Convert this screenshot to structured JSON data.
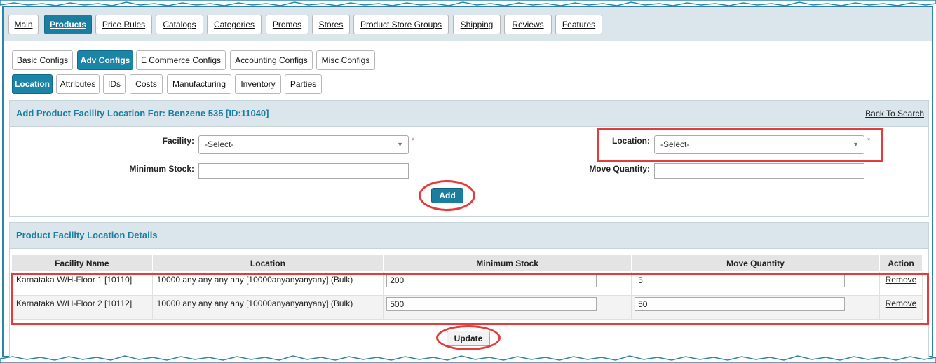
{
  "main_tabs": [
    {
      "label": "Main",
      "active": false
    },
    {
      "label": "Products",
      "active": true
    },
    {
      "label": "Price Rules",
      "active": false
    },
    {
      "label": "Catalogs",
      "active": false
    },
    {
      "label": "Categories",
      "active": false
    },
    {
      "label": "Promos",
      "active": false
    },
    {
      "label": "Stores",
      "active": false
    },
    {
      "label": "Product Store Groups",
      "active": false
    },
    {
      "label": "Shipping",
      "active": false
    },
    {
      "label": "Reviews",
      "active": false
    },
    {
      "label": "Features",
      "active": false
    }
  ],
  "config_tabs": [
    {
      "label": "Basic Configs",
      "active": false
    },
    {
      "label": "Adv Configs",
      "active": true
    },
    {
      "label": "E Commerce Configs",
      "active": false
    },
    {
      "label": "Accounting Configs",
      "active": false
    },
    {
      "label": "Misc Configs",
      "active": false
    }
  ],
  "sub_tabs": [
    {
      "label": "Location",
      "active": true
    },
    {
      "label": "Attributes",
      "active": false
    },
    {
      "label": "IDs",
      "active": false
    },
    {
      "label": "Costs",
      "active": false
    },
    {
      "label": "Manufacturing",
      "active": false
    },
    {
      "label": "Inventory",
      "active": false
    },
    {
      "label": "Parties",
      "active": false
    }
  ],
  "add_form": {
    "title": "Add Product Facility Location For: Benzene 535 [ID:11040]",
    "back_link": "Back To Search",
    "facility_label": "Facility:",
    "facility_value": "-Select-",
    "location_label": "Location:",
    "location_value": "-Select-",
    "min_stock_label": "Minimum Stock:",
    "min_stock_value": "",
    "move_qty_label": "Move Quantity:",
    "move_qty_value": "",
    "required_mark": "*",
    "add_button": "Add"
  },
  "details": {
    "title": "Product Facility Location Details",
    "columns": [
      "Facility Name",
      "Location",
      "Minimum Stock",
      "Move Quantity",
      "Action"
    ],
    "rows": [
      {
        "facility": "Karnataka W/H-Floor 1 [10110]",
        "location": "10000 any any any any [10000anyanyanyany] (Bulk)",
        "min_stock": "200",
        "move_qty": "5",
        "action": "Remove"
      },
      {
        "facility": "Karnataka W/H-Floor 2 [10112]",
        "location": "10000 any any any any [10000anyanyanyany] (Bulk)",
        "min_stock": "500",
        "move_qty": "50",
        "action": "Remove"
      }
    ],
    "update_button": "Update"
  },
  "colors": {
    "accent": "#1b7ea0",
    "highlight": "#e63b3b",
    "panel_bg": "#dbe6ec"
  }
}
